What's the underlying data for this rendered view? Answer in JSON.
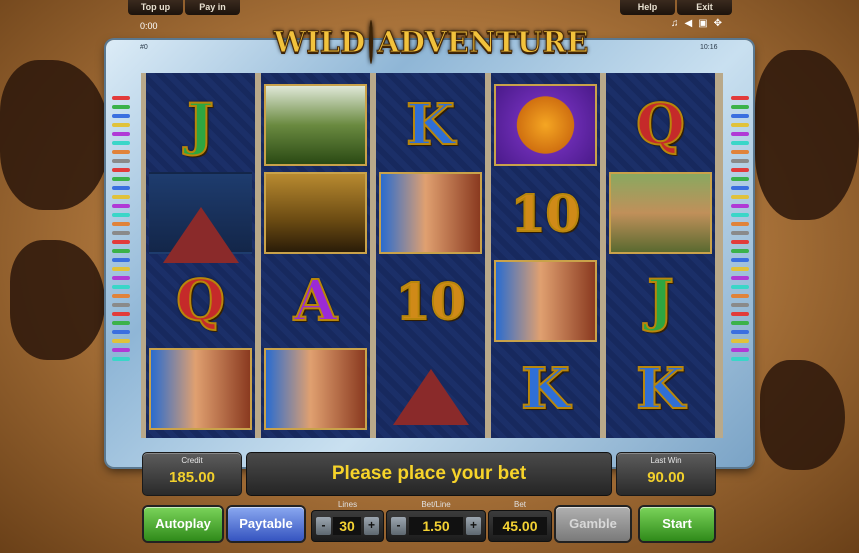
{
  "topbar": {
    "topup": "Top up",
    "payin": "Pay in",
    "help": "Help",
    "exit": "Exit",
    "clock_left": "0:00",
    "clock_right": "10:16",
    "counter": "#0"
  },
  "logo": {
    "word1": "WILD",
    "word2": "ADVENTURE"
  },
  "reels": [
    [
      "J",
      "camp-symbol",
      "mountain-symbol",
      "Q",
      "heroine-symbol"
    ],
    [
      "jungle-symbol",
      "jeep-symbol",
      "A",
      "heroine-symbol"
    ],
    [
      "K",
      "heroine-symbol",
      "10",
      "mountain-symbol"
    ],
    [
      "compass-symbol",
      "10",
      "heroine-symbol",
      "K"
    ],
    [
      "Q",
      "explorer-symbol",
      "J",
      "K"
    ]
  ],
  "info": {
    "credit_label": "Credit",
    "credit": "185.00",
    "message": "Please place your bet",
    "lastwin_label": "Last Win",
    "lastwin": "90.00"
  },
  "controls": {
    "autoplay": "Autoplay",
    "paytable": "Paytable",
    "lines_label": "Lines",
    "lines": "30",
    "betline_label": "Bet/Line",
    "betline": "1.50",
    "bet_label": "Bet",
    "bet": "45.00",
    "gamble": "Gamble",
    "start": "Start",
    "minus": "-",
    "plus": "+"
  },
  "colors": {
    "gold": "#f2d02c",
    "reel_bg": "#17295e",
    "frame": "#8fb6d6",
    "green": "#3fa12a",
    "blue": "#4b6ed8"
  }
}
